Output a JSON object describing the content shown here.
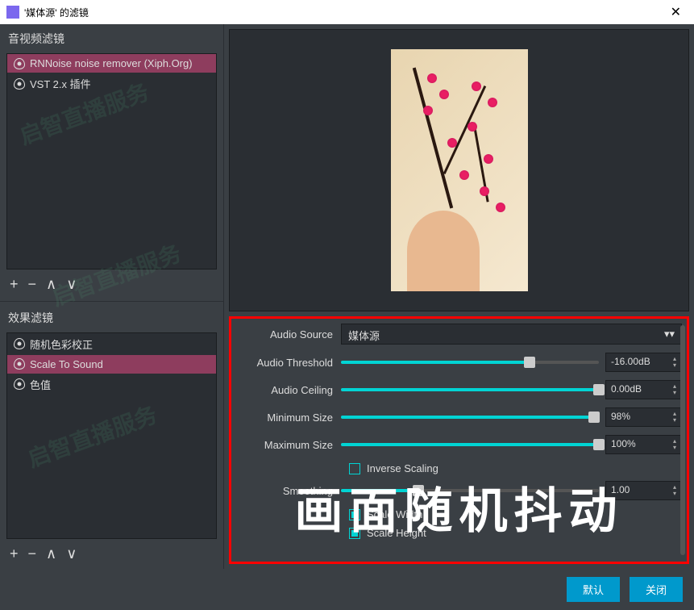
{
  "title": "'媒体源' 的滤镜",
  "sections": {
    "av_filters": "音视频滤镜",
    "effect_filters": "效果滤镜"
  },
  "av_filter_items": [
    {
      "label": "RNNoise noise remover (Xiph.Org)",
      "selected": true
    },
    {
      "label": "VST 2.x 插件",
      "selected": false
    }
  ],
  "effect_filter_items": [
    {
      "label": "随机色彩校正",
      "selected": false
    },
    {
      "label": "Scale To Sound",
      "selected": true
    },
    {
      "label": "色值",
      "selected": false
    }
  ],
  "props": {
    "audio_source_label": "Audio Source",
    "audio_source_value": "媒体源",
    "audio_threshold_label": "Audio Threshold",
    "audio_threshold_value": "-16.00dB",
    "audio_threshold_pct": 73,
    "audio_ceiling_label": "Audio Ceiling",
    "audio_ceiling_value": "0.00dB",
    "audio_ceiling_pct": 100,
    "min_size_label": "Minimum Size",
    "min_size_value": "98%",
    "min_size_pct": 98,
    "max_size_label": "Maximum Size",
    "max_size_value": "100%",
    "max_size_pct": 100,
    "inverse_scaling_label": "Inverse Scaling",
    "smoothing_label": "Smoothing",
    "smoothing_value": "1.00",
    "smoothing_pct": 30,
    "scale_width_label": "Scale Width",
    "scale_height_label": "Scale Height"
  },
  "overlay": "画面随机抖动",
  "buttons": {
    "default": "默认",
    "close": "关闭"
  },
  "watermark": "启智直播服务"
}
